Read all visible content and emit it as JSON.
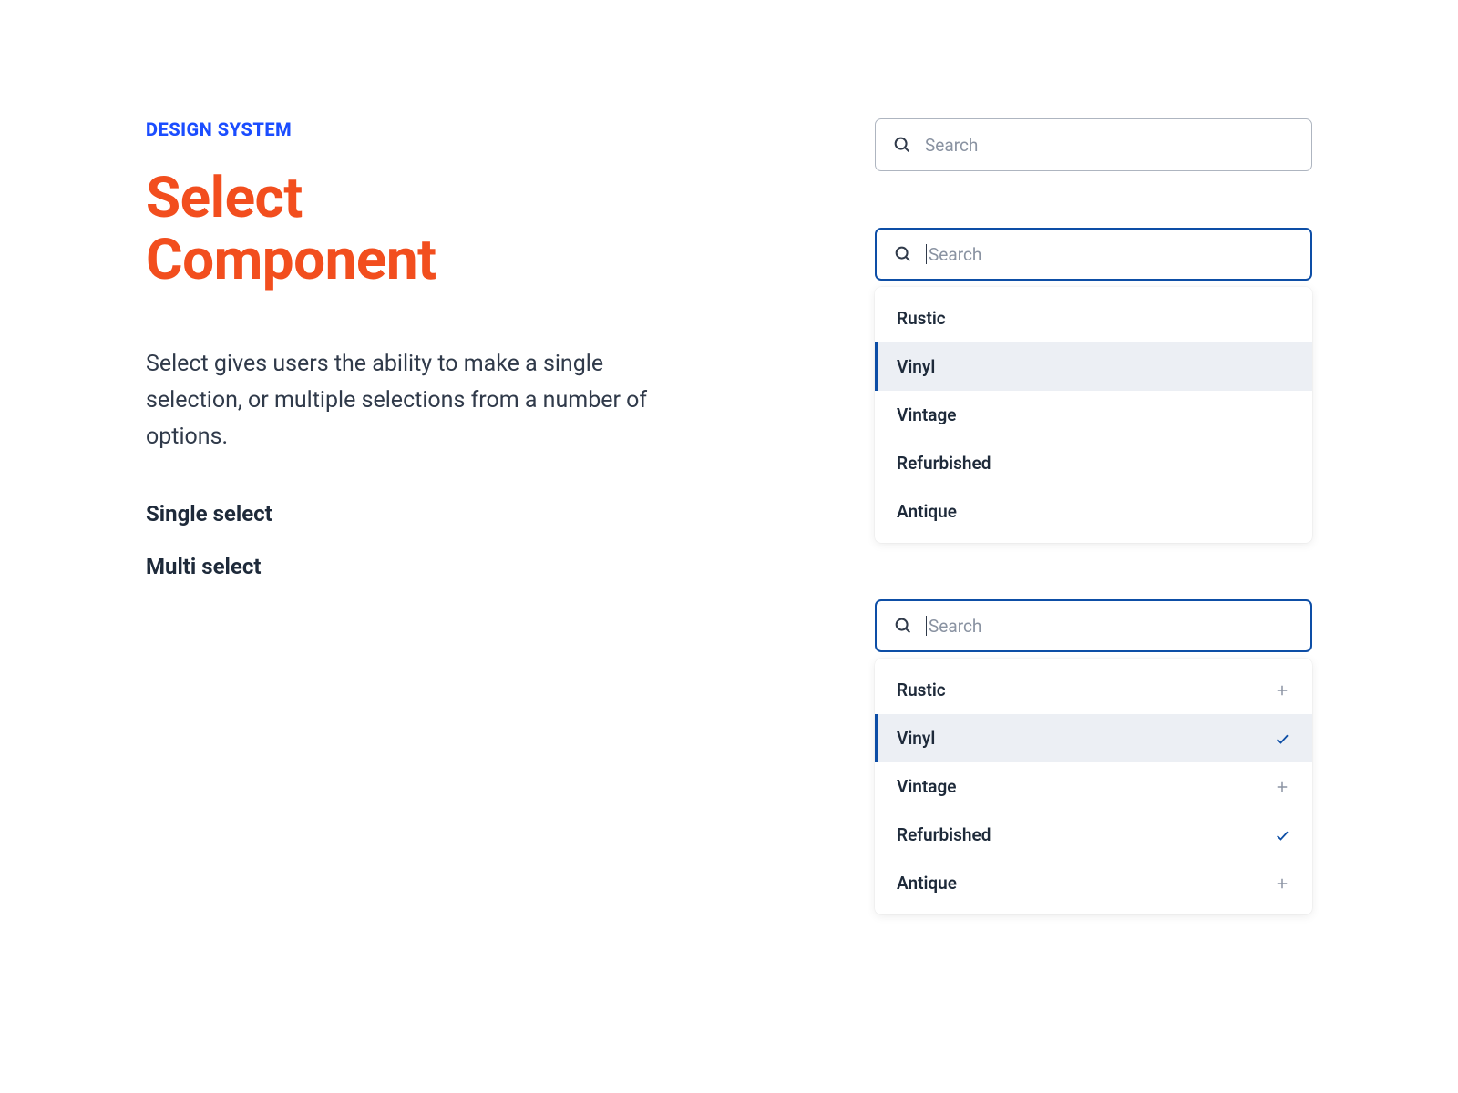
{
  "eyebrow": "DESIGN SYSTEM",
  "title_line1": "Select",
  "title_line2": "Component",
  "description": "Select gives users the ability to make a single selection, or multiple selections from a number of options.",
  "variants": {
    "single": "Single select",
    "multi": "Multi select"
  },
  "search": {
    "placeholder": "Search"
  },
  "options": {
    "rustic": "Rustic",
    "vinyl": "Vinyl",
    "vintage": "Vintage",
    "refurbished": "Refurbished",
    "antique": "Antique"
  },
  "colors": {
    "accent_blue": "#1B4DFF",
    "accent_orange": "#F24E1E",
    "focus_border": "#0D4EA6",
    "text_dark": "#1E2A3A",
    "text_body": "#303A4A",
    "text_muted": "#8A93A2",
    "highlight_bg": "#ECEFF4"
  }
}
